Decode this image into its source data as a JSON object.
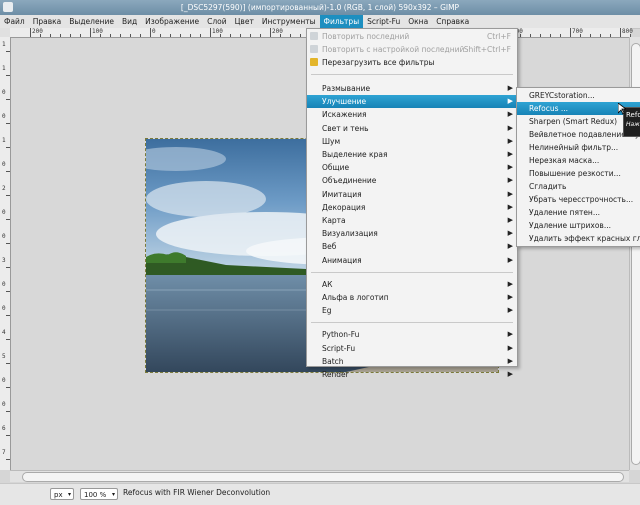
{
  "window": {
    "title": "[_DSC5297(590)] (импортированный)-1.0 (RGB, 1 слой) 590x392 – GIMP"
  },
  "menubar": [
    "Файл",
    "Правка",
    "Выделение",
    "Вид",
    "Изображение",
    "Слой",
    "Цвет",
    "Инструменты",
    "Фильтры",
    "Script-Fu",
    "Окна",
    "Справка"
  ],
  "rulers": {
    "h": [
      "200",
      "100",
      "0",
      "100",
      "200",
      "300",
      "400",
      "500",
      "600",
      "700",
      "800"
    ],
    "v": [
      "1",
      "1",
      "0",
      "0",
      "1",
      "0",
      "2",
      "0",
      "0",
      "3",
      "0",
      "0",
      "4",
      "5",
      "0",
      "0",
      "6",
      "7"
    ]
  },
  "filters_menu": {
    "top": [
      {
        "label": "Повторить последний",
        "accel": "Ctrl+F",
        "disabled": true
      },
      {
        "label": "Повторить с настройкой последний",
        "accel": "Shift+Ctrl+F",
        "disabled": true
      },
      {
        "label": "Перезагрузить все фильтры",
        "accel": "",
        "disabled": false
      }
    ],
    "group1": [
      "Размывание",
      "Улучшение",
      "Искажения",
      "Свет и тень",
      "Шум",
      "Выделение края",
      "Общие",
      "Объединение",
      "Имитация",
      "Декорация",
      "Карта",
      "Визуализация",
      "Веб",
      "Анимация"
    ],
    "group2": [
      "АК",
      "Альфа в логотип",
      "Eg"
    ],
    "group3": [
      "Python-Fu",
      "Script-Fu",
      "Batch",
      "Render"
    ]
  },
  "enhance_menu": [
    "GREYCstoration...",
    "Refocus ...",
    "Sharpen (Smart Redux)",
    "Вейвлетное подавление шума...",
    "Нелинейный фильтр...",
    "Нерезкая маска...",
    "Повышение резкости...",
    "Сгладить",
    "Убрать чересстрочность...",
    "Удаление пятен...",
    "Удаление штрихов...",
    "Удалить эффект красных глаз..."
  ],
  "tooltip": {
    "title": "Refocus",
    "sub": "Нажмите"
  },
  "statusbar": {
    "unit": "px",
    "zoom": "100 %",
    "message": "Refocus with FIR Wiener Deconvolution"
  },
  "colors": {
    "accent": "#1d8fc0",
    "title": "#7a97ac"
  }
}
